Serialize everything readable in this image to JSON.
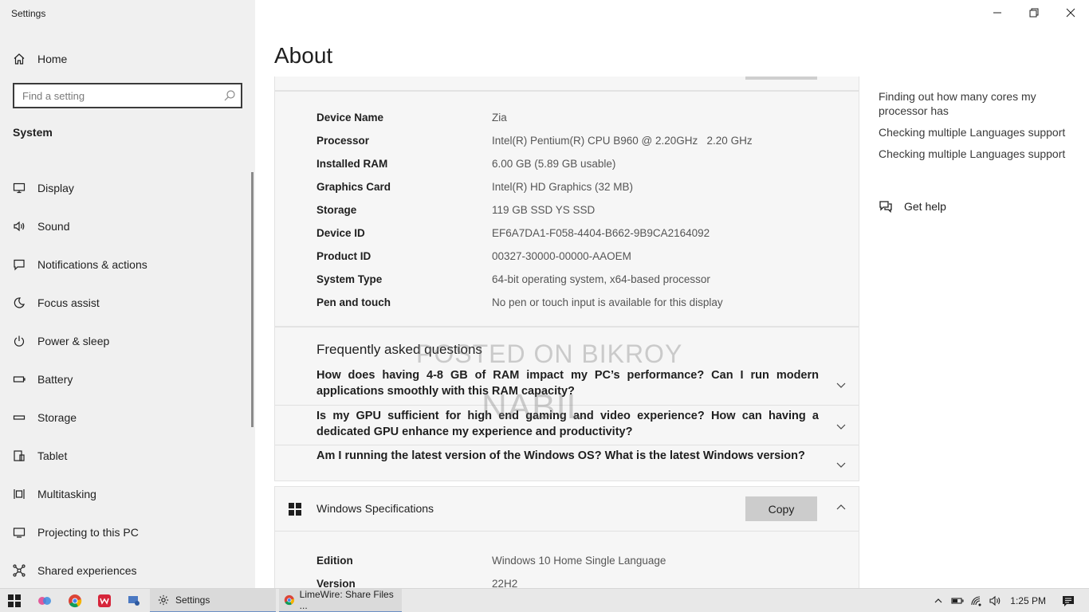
{
  "window": {
    "app_title": "Settings"
  },
  "sidebar": {
    "home_label": "Home",
    "search_placeholder": "Find a setting",
    "section_title": "System",
    "items": [
      {
        "label": "Display",
        "icon": "display-icon"
      },
      {
        "label": "Sound",
        "icon": "sound-icon"
      },
      {
        "label": "Notifications & actions",
        "icon": "notifications-icon"
      },
      {
        "label": "Focus assist",
        "icon": "focus-assist-icon"
      },
      {
        "label": "Power & sleep",
        "icon": "power-icon"
      },
      {
        "label": "Battery",
        "icon": "battery-icon"
      },
      {
        "label": "Storage",
        "icon": "storage-icon"
      },
      {
        "label": "Tablet",
        "icon": "tablet-icon"
      },
      {
        "label": "Multitasking",
        "icon": "multitasking-icon"
      },
      {
        "label": "Projecting to this PC",
        "icon": "projecting-icon"
      },
      {
        "label": "Shared experiences",
        "icon": "shared-experiences-icon"
      }
    ]
  },
  "main": {
    "page_title": "About",
    "device_specs": [
      {
        "label": "Device Name",
        "value": "Zia"
      },
      {
        "label": "Processor",
        "value": "Intel(R) Pentium(R) CPU B960 @ 2.20GHz   2.20 GHz"
      },
      {
        "label": "Installed RAM",
        "value": "6.00 GB (5.89 GB usable)"
      },
      {
        "label": "Graphics Card",
        "value": "Intel(R) HD Graphics (32 MB)"
      },
      {
        "label": "Storage",
        "value": "119 GB SSD YS SSD"
      },
      {
        "label": "Device ID",
        "value": "EF6A7DA1-F058-4404-B662-9B9CA2164092"
      },
      {
        "label": "Product ID",
        "value": "00327-30000-00000-AAOEM"
      },
      {
        "label": "System Type",
        "value": "64-bit operating system, x64-based processor"
      },
      {
        "label": "Pen and touch",
        "value": "No pen or touch input is available for this display"
      }
    ],
    "faq": {
      "title": "Frequently asked questions",
      "questions": [
        "How does having 4-8 GB of RAM impact my PC’s performance? Can I run modern applications smoothly with this RAM capacity?",
        "Is my GPU sufficient for high end gaming and video experience? How can having a dedicated GPU enhance my experience and productivity?",
        "Am I running the latest version of the Windows OS? What is the latest Windows version?"
      ]
    },
    "windows_specs": {
      "title": "Windows Specifications",
      "copy_label": "Copy",
      "rows": [
        {
          "label": "Edition",
          "value": "Windows 10 Home Single Language"
        },
        {
          "label": "Version",
          "value": "22H2"
        }
      ]
    },
    "watermark": {
      "line1": "POSTED ON BIKROY",
      "line2": "NABIL"
    }
  },
  "related": {
    "links": [
      "Finding out how many cores my processor has",
      "Checking multiple Languages support",
      "Checking multiple Languages support"
    ],
    "help_label": "Get help"
  },
  "taskbar": {
    "apps": [
      {
        "label": "Settings"
      },
      {
        "label": "LimeWire: Share Files ..."
      }
    ],
    "time": "1:25 PM"
  }
}
